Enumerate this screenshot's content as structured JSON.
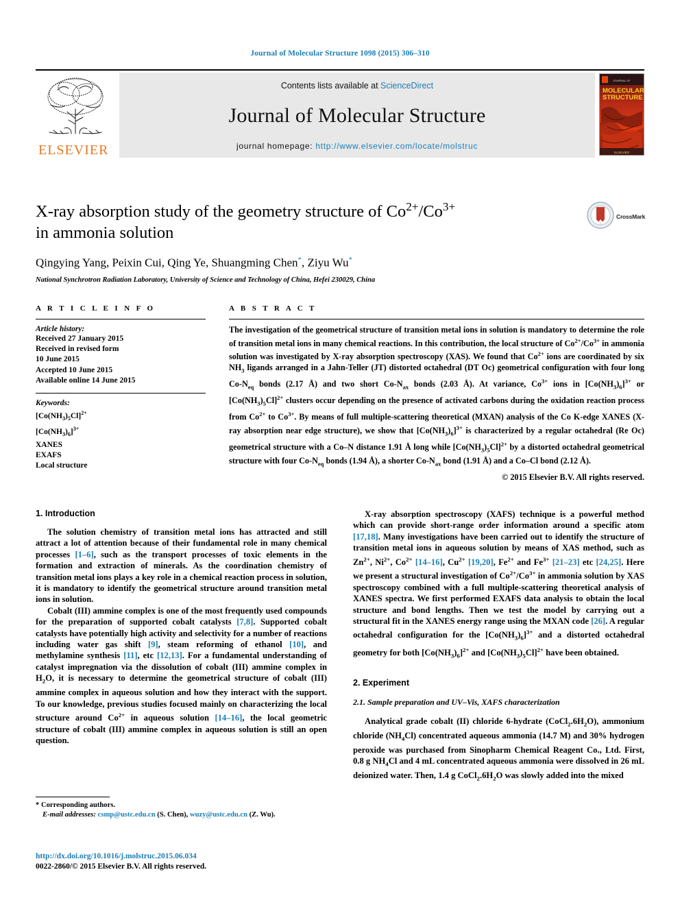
{
  "running_head": "Journal of Molecular Structure 1098 (2015) 306–310",
  "masthead": {
    "contents_prefix": "Contents lists available at ",
    "sciencedirect": "ScienceDirect",
    "journal_name": "Journal of Molecular Structure",
    "homepage_prefix": "journal homepage: ",
    "homepage_url": "http://www.elsevier.com/locate/molstruc",
    "publisher": "ELSEVIER",
    "cover_line1": "MOLECULAR",
    "cover_line2": "STRUCTURE",
    "accent_blue": "#1a7db6",
    "elsevier_orange": "#e87722"
  },
  "title": {
    "line1": "X-ray absorption study of the geometry structure of Co",
    "line1_sup1": "2+",
    "line1_mid": "/Co",
    "line1_sup2": "3+",
    "line2": "in ammonia solution"
  },
  "authors": "Qingying Yang, Peixin Cui, Qing Ye, Shuangming Chen",
  "authors_tail": ", Ziyu Wu",
  "affiliation": "National Synchrotron Radiation Laboratory, University of Science and Technology of China, Hefei 230029, China",
  "crossmark": {
    "label": "CrossMark"
  },
  "article_info": {
    "heading": "A R T I C L E   I N F O",
    "history_title": "Article history:",
    "history": [
      "Received 27 January 2015",
      "Received in revised form",
      "10 June 2015",
      "Accepted 10 June 2015",
      "Available online 14 June 2015"
    ],
    "keywords_title": "Keywords:",
    "keywords": [
      "[Co(NH3)5Cl]2+",
      "[Co(NH3)6]3+",
      "XANES",
      "EXAFS",
      "Local structure"
    ]
  },
  "abstract": {
    "heading": "A B S T R A C T",
    "text": "The investigation of the geometrical structure of transition metal ions in solution is mandatory to determine the role of transition metal ions in many chemical reactions. In this contribution, the local structure of Co2+/Co3+ in ammonia solution was investigated by X-ray absorption spectroscopy (XAS). We found that Co2+ ions are coordinated by six NH3 ligands arranged in a Jahn-Teller (JT) distorted octahedral (DT Oc) geometrical configuration with four long Co-Neq bonds (2.17 Å) and two short Co-Nax bonds (2.03 Å). At variance, Co3+ ions in [Co(NH3)6]3+ or [Co(NH3)5Cl]2+ clusters occur depending on the presence of activated carbons during the oxidation reaction process from Co2+ to Co3+. By means of full multiple-scattering theoretical (MXAN) analysis of the Co K-edge XANES (X-ray absorption near edge structure), we show that [Co(NH3)6]3+ is characterized by a regular octahedral (Re Oc) geometrical structure with a Co–N distance 1.91 Å long while [Co(NH3)5Cl]2+ by a distorted octahedral geometrical structure with four Co-Neq bonds (1.94 Å), a shorter Co-Nax bond (1.91 Å) and a Co–Cl bond (2.12 Å).",
    "copyright": "© 2015 Elsevier B.V. All rights reserved."
  },
  "sections": {
    "intro_heading": "1. Introduction",
    "experiment_heading": "2. Experiment",
    "experiment_sub": "2.1. Sample preparation and UV–Vis, XAFS characterization"
  },
  "paragraphs": {
    "p1": "The solution chemistry of transition metal ions has attracted and still attract a lot of attention because of their fundamental role in many chemical processes [1–6], such as the transport processes of toxic elements in the formation and extraction of minerals. As the coordination chemistry of transition metal ions plays a key role in a chemical reaction process in solution, it is mandatory to identify the geometrical structure around transition metal ions in solution.",
    "p2": "Cobalt (III) ammine complex is one of the most frequently used compounds for the preparation of supported cobalt catalysts [7,8]. Supported cobalt catalysts have potentially high activity and selectivity for a number of reactions including water gas shift [9], steam reforming of ethanol [10], and methylamine synthesis [11], etc [12,13]. For a fundamental understanding of catalyst impregnation via the dissolution of cobalt (III) ammine complex in H2O, it is necessary to determine the geometrical structure of cobalt (III) ammine complex in aqueous solution and how they interact with the support. To our knowledge, previous studies focused mainly on characterizing the local structure around Co2+ in aqueous solution [14–16], the local geometric structure of cobalt (III) ammine complex in aqueous solution is still an open question.",
    "p3": "X-ray absorption spectroscopy (XAFS) technique is a powerful method which can provide short-range order information around a specific atom [17,18]. Many investigations have been carried out to identify the structure of transition metal ions in aqueous solution by means of XAS method, such as Zn2+, Ni2+, Co2+ [14–16], Cu2+ [19,20], Fe2+ and Fe3+ [21–23] etc [24,25]. Here we present a structural investigation of Co2+/Co3+ in ammonia solution by XAS spectroscopy combined with a full multiple-scattering theoretical analysis of XANES spectra. We first performed EXAFS data analysis to obtain the local structure and bond lengths. Then we test the model by carrying out a structural fit in the XANES energy range using the MXAN code [26]. A regular octahedral configuration for the [Co(NH3)6]3+ and a distorted octahedral geometry for both [Co(NH3)6]2+ and [Co(NH3)5Cl]2+ have been obtained.",
    "p4": "Analytical grade cobalt (II) chloride 6-hydrate (CoCl2.6H2O), ammonium chloride (NH4Cl) concentrated aqueous ammonia (14.7 M) and 30% hydrogen peroxide was purchased from Sinopharm Chemical Reagent Co., Ltd. First, 0.8 g NH4Cl and 4 mL concentrated aqueous ammonia were dissolved in 26 mL deionized water. Then, 1.4 g CoCl2.6H2O was slowly added into the mixed"
  },
  "footnote": {
    "corresponding": "* Corresponding authors.",
    "email_label": "E-mail addresses:",
    "email1": "csmp@ustc.edu.cn",
    "email1_who": " (S. Chen), ",
    "email2": "wuzy@ustc.edu.cn",
    "email2_who": " (Z. Wu)."
  },
  "footer": {
    "doi": "http://dx.doi.org/10.1016/j.molstruc.2015.06.034",
    "issn": "0022-2860/© 2015 Elsevier B.V. All rights reserved."
  }
}
